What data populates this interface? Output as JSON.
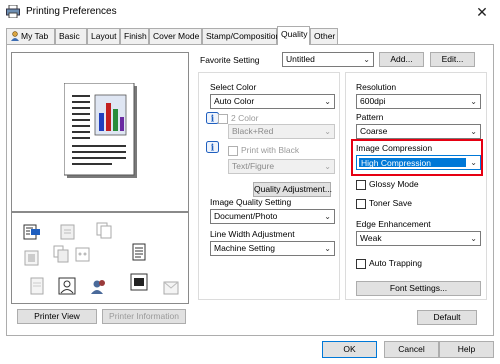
{
  "window": {
    "title": "Printing Preferences",
    "close_glyph": "✕"
  },
  "tabs": [
    {
      "label": "My Tab"
    },
    {
      "label": "Basic"
    },
    {
      "label": "Layout"
    },
    {
      "label": "Finish"
    },
    {
      "label": "Cover Mode"
    },
    {
      "label": "Stamp/Composition"
    },
    {
      "label": "Quality"
    },
    {
      "label": "Other"
    }
  ],
  "active_tab": "Quality",
  "left_panel": {
    "printer_view_label": "Printer View",
    "printer_information_label": "Printer Information"
  },
  "favorite": {
    "label": "Favorite Setting",
    "value": "Untitled",
    "add_label": "Add...",
    "edit_label": "Edit..."
  },
  "quality": {
    "select_color_label": "Select Color",
    "select_color_value": "Auto Color",
    "two_color_label": "2 Color",
    "two_color_value": "Black+Red",
    "print_with_black_label": "Print with Black",
    "text_figure_value": "Text/Figure",
    "quality_adjustment_label": "Quality Adjustment...",
    "image_quality_setting_label": "Image Quality Setting",
    "image_quality_setting_value": "Document/Photo",
    "line_width_adjustment_label": "Line Width Adjustment",
    "line_width_adjustment_value": "Machine Setting"
  },
  "right": {
    "resolution_label": "Resolution",
    "resolution_value": "600dpi",
    "pattern_label": "Pattern",
    "pattern_value": "Coarse",
    "image_compression_label": "Image Compression",
    "image_compression_value": "High Compression",
    "glossy_mode_label": "Glossy Mode",
    "toner_save_label": "Toner Save",
    "edge_enhancement_label": "Edge Enhancement",
    "edge_enhancement_value": "Weak",
    "auto_trapping_label": "Auto Trapping",
    "font_settings_label": "Font Settings..."
  },
  "default_label": "Default",
  "footer": {
    "ok_label": "OK",
    "cancel_label": "Cancel",
    "help_label": "Help"
  },
  "colors": {
    "highlight": "#0078d7",
    "callout": "#e60012"
  }
}
